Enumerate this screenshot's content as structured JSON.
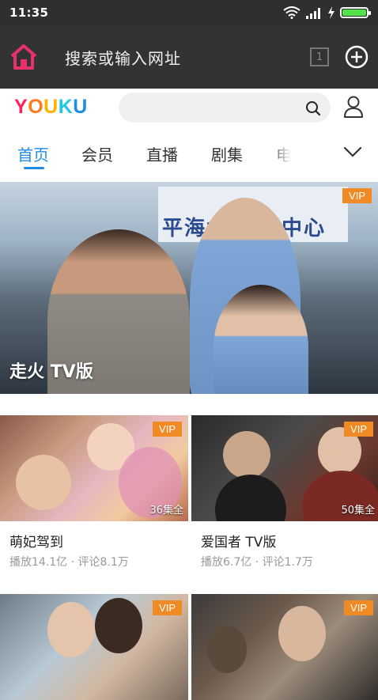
{
  "status_bar": {
    "time": "11:35"
  },
  "browser": {
    "url_placeholder": "搜索或输入网址",
    "tab_count": "1"
  },
  "youku": {
    "logo": "YOUKU",
    "logo_colors": [
      "#ff1f5a",
      "#ff7a1a",
      "#ffb100",
      "#1ec8e8",
      "#1f8de8"
    ]
  },
  "nav": {
    "tabs": [
      "首页",
      "会员",
      "直播",
      "剧集",
      "电"
    ],
    "active_index": 0
  },
  "hero": {
    "title": "走火 TV版",
    "badge": "VIP",
    "wall_text": "平海北 指挥中心"
  },
  "cards": [
    {
      "title": "萌妃驾到",
      "meta": "播放14.1亿 · 评论8.1万",
      "episodes": "36集全",
      "badge": "VIP"
    },
    {
      "title": "爱国者 TV版",
      "meta": "播放6.7亿 · 评论1.7万",
      "episodes": "50集全",
      "badge": "VIP"
    },
    {
      "title": "",
      "meta": "",
      "episodes": "",
      "badge": "VIP"
    },
    {
      "title": "",
      "meta": "",
      "episodes": "",
      "badge": "VIP"
    }
  ],
  "colors": {
    "accent": "#1f8de8",
    "vip_badge": "#f08a24",
    "home_icon": "#e8306a"
  }
}
